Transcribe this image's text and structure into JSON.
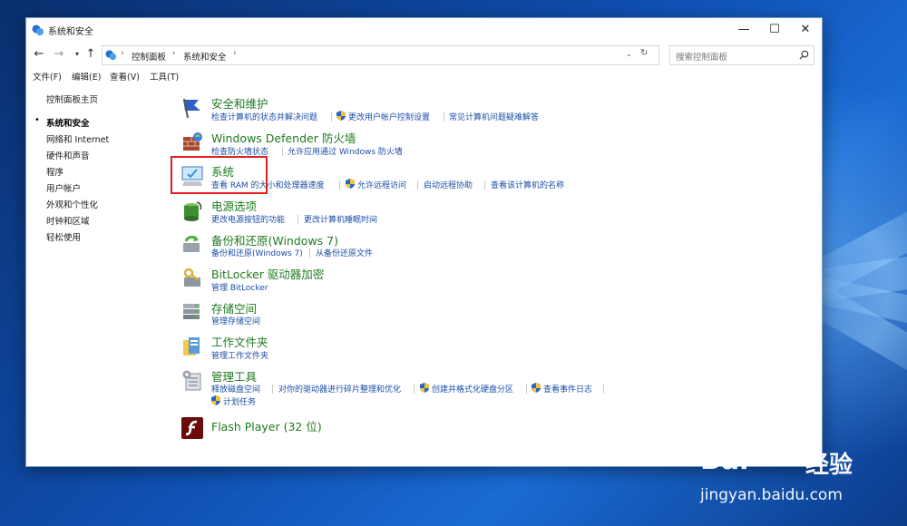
{
  "window": {
    "title": "系统和安全",
    "controls": {
      "minimize": "—",
      "maximize": "☐",
      "close": "✕"
    }
  },
  "address": {
    "crumbs": [
      "控制面板",
      "系统和安全"
    ],
    "search_placeholder": "搜索控制面板"
  },
  "menu": [
    "文件(F)",
    "编辑(E)",
    "查看(V)",
    "工具(T)"
  ],
  "sidebar": {
    "items": [
      {
        "label": "控制面板主页"
      },
      {
        "label": "系统和安全",
        "current": true
      },
      {
        "label": "网络和 Internet"
      },
      {
        "label": "硬件和声音"
      },
      {
        "label": "程序"
      },
      {
        "label": "用户帐户"
      },
      {
        "label": "外观和个性化"
      },
      {
        "label": "时钟和区域"
      },
      {
        "label": "轻松使用"
      }
    ]
  },
  "categories": [
    {
      "title": "安全和维护",
      "tasks": [
        "检查计算机的状态并解决问题",
        "更改用户帐户控制设置",
        "常见计算机问题疑难解答"
      ]
    },
    {
      "title": "Windows Defender 防火墙",
      "tasks": [
        "检查防火墙状态",
        "允许应用通过 Windows 防火墙"
      ]
    },
    {
      "title": "系统",
      "tasks": [
        "查看 RAM 的大小和处理器速度",
        "允许远程访问",
        "启动远程协助",
        "查看该计算机的名称"
      ]
    },
    {
      "title": "电源选项",
      "tasks": [
        "更改电源按钮的功能",
        "更改计算机睡眠时间"
      ]
    },
    {
      "title": "备份和还原(Windows 7)",
      "tasks": [
        "备份和还原(Windows 7)",
        "从备份还原文件"
      ]
    },
    {
      "title": "BitLocker 驱动器加密",
      "tasks": [
        "管理 BitLocker"
      ]
    },
    {
      "title": "存储空间",
      "tasks": [
        "管理存储空间"
      ]
    },
    {
      "title": "工作文件夹",
      "tasks": [
        "管理工作文件夹"
      ]
    },
    {
      "title": "管理工具",
      "tasks": [
        "释放磁盘空间",
        "对你的驱动器进行碎片整理和优化",
        "创建并格式化硬盘分区",
        "查看事件日志",
        "计划任务"
      ]
    },
    {
      "title": "Flash Player (32 位)",
      "tasks": []
    }
  ],
  "watermark": {
    "brand": "Bai",
    "brand2": "经验",
    "url": "jingyan.baidu.com"
  },
  "colors": {
    "link": "#1a4ea8",
    "category": "#1e7b1e",
    "highlight": "#e11f1f"
  }
}
